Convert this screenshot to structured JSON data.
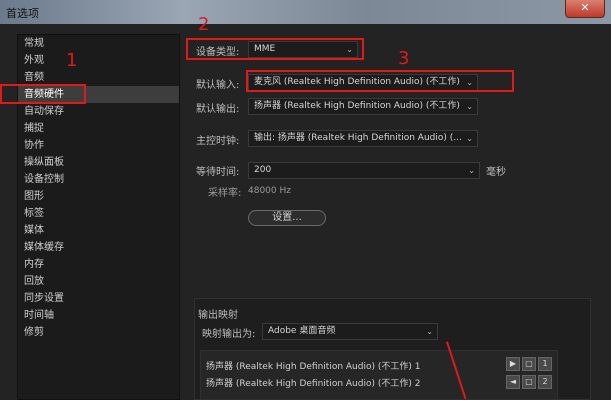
{
  "window": {
    "title": "首选项",
    "close_label": "✕"
  },
  "sidebar": {
    "items": [
      {
        "label": "常规"
      },
      {
        "label": "外观"
      },
      {
        "label": "音频"
      },
      {
        "label": "音频硬件",
        "active": true
      },
      {
        "label": "自动保存"
      },
      {
        "label": "捕捉"
      },
      {
        "label": "协作"
      },
      {
        "label": "操纵面板"
      },
      {
        "label": "设备控制"
      },
      {
        "label": "图形"
      },
      {
        "label": "标签"
      },
      {
        "label": "媒体"
      },
      {
        "label": "媒体缓存"
      },
      {
        "label": "内存"
      },
      {
        "label": "回放"
      },
      {
        "label": "同步设置"
      },
      {
        "label": "时间轴"
      },
      {
        "label": "修剪"
      }
    ]
  },
  "audio_hw": {
    "device_type_label": "设备类型:",
    "device_type_value": "MME",
    "default_input_label": "默认输入:",
    "default_input_value": "麦克风 (Realtek High Definition Audio) (不工作)",
    "default_output_label": "默认输出:",
    "default_output_value": "扬声器 (Realtek High Definition Audio) (不工作)",
    "master_clock_label": "主控时钟:",
    "master_clock_value": "输出: 扬声器 (Realtek High Definition Audio) (...",
    "latency_label": "等待时间:",
    "latency_value": "200",
    "latency_unit": "毫秒",
    "sample_rate_label": "采样率:",
    "sample_rate_value": "48000 Hz",
    "settings_button": "设置..."
  },
  "output_mapping": {
    "section_title": "输出映射",
    "map_to_label": "映射输出为:",
    "map_to_value": "Adobe 桌面音频",
    "rows": [
      {
        "label": "扬声器 (Realtek High Definition Audio) (不工作) 1",
        "channel": "1"
      },
      {
        "label": "扬声器 (Realtek High Definition Audio) (不工作) 2",
        "channel": "2"
      }
    ]
  },
  "annotations": {
    "n1": "1",
    "n2": "2",
    "n3": "3"
  },
  "colors": {
    "annotation": "#e01a1a",
    "panel_bg": "#232323"
  },
  "icons": {
    "dropdown": "chevron-down-icon"
  }
}
